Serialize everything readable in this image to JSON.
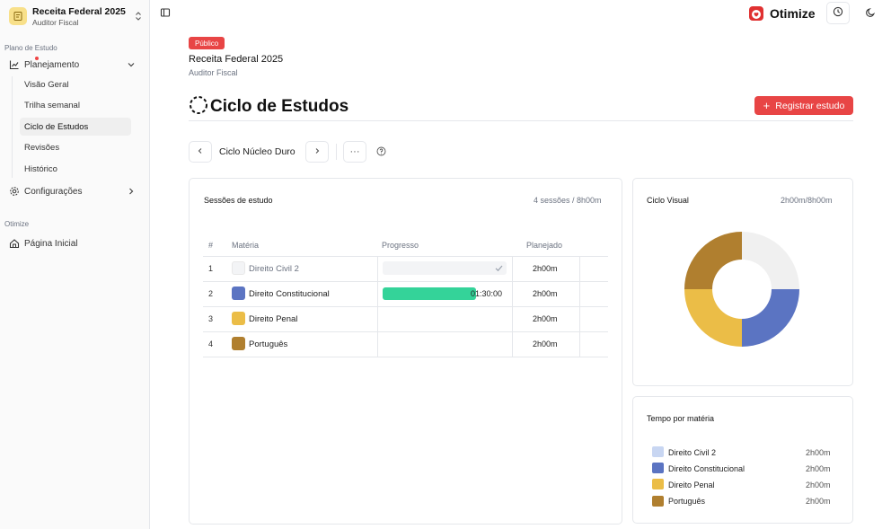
{
  "workspace": {
    "title": "Receita Federal 2025",
    "subtitle": "Auditor Fiscal"
  },
  "sidebar": {
    "group1": "Plano de Estudo",
    "planning": "Planejamento",
    "sub_items": [
      "Visão Geral",
      "Trilha semanal",
      "Ciclo de Estudos",
      "Revisões",
      "Histórico"
    ],
    "settings": "Configurações",
    "group2": "Otimize",
    "home": "Página Inicial"
  },
  "header": {
    "brand": "Otimize"
  },
  "project": {
    "badge": "Público",
    "title": "Receita Federal 2025",
    "subtitle": "Auditor Fiscal"
  },
  "page": {
    "title": "Ciclo de Estudos",
    "register_button": "Registrar estudo"
  },
  "cycle": {
    "name": "Ciclo Núcleo Duro",
    "more": "···"
  },
  "sessions": {
    "title": "Sessões de estudo",
    "summary": "4 sessões / 8h00m",
    "columns": [
      "#",
      "Matéria",
      "Progresso",
      "Planejado"
    ],
    "rows": [
      {
        "n": "1",
        "subject": "Direito Civil 2",
        "color": "#f3f4f6",
        "progress": "",
        "progress_fraction": 1.0,
        "planned": "2h00m"
      },
      {
        "n": "2",
        "subject": "Direito Constitucional",
        "color": "#5b74c2",
        "progress": "01:30:00",
        "progress_fraction": 0.75,
        "planned": "2h00m"
      },
      {
        "n": "3",
        "subject": "Direito Penal",
        "color": "#ebbd47",
        "progress": "",
        "progress_fraction": 0,
        "planned": "2h00m"
      },
      {
        "n": "4",
        "subject": "Português",
        "color": "#b07f2f",
        "progress": "",
        "progress_fraction": 0,
        "planned": "2h00m"
      }
    ]
  },
  "visual": {
    "title": "Ciclo Visual",
    "summary": "2h00m/8h00m"
  },
  "chart_data": {
    "type": "pie",
    "donut": true,
    "categories": [
      "Direito Civil 2",
      "Direito Constitucional",
      "Direito Penal",
      "Português"
    ],
    "values": [
      2,
      2,
      2,
      2
    ],
    "colors": [
      "#f0f0f0",
      "#5b74c2",
      "#ebbd47",
      "#b07f2f"
    ]
  },
  "time_by_subject": {
    "title": "Tempo por matéria",
    "items": [
      {
        "name": "Direito Civil 2",
        "value": "2h00m",
        "color": "#c8d6f2"
      },
      {
        "name": "Direito Constitucional",
        "value": "2h00m",
        "color": "#5b74c2"
      },
      {
        "name": "Direito Penal",
        "value": "2h00m",
        "color": "#ebbd47"
      },
      {
        "name": "Português",
        "value": "2h00m",
        "color": "#b07f2f"
      }
    ]
  }
}
